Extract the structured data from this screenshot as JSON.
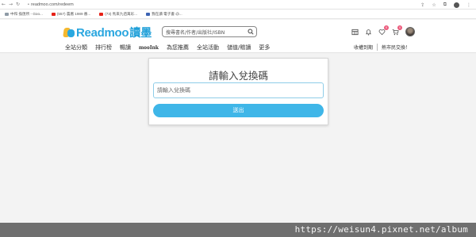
{
  "browser": {
    "url": "readmoo.com/redeem",
    "nav": {
      "back": "←",
      "forward": "→",
      "reload": "↻",
      "lock": "🔒"
    },
    "right_icons": {
      "share": "⇪",
      "star": "☆",
      "extensions": "⧉",
      "menu": "⋮"
    },
    "bookmarks": [
      {
        "icon": "grey",
        "label": "中和 換匯所 - Goo..."
      },
      {
        "icon": "red",
        "label": "(557) 農曆 1989 番..."
      },
      {
        "icon": "red",
        "label": "(73) 馬來九佰萬彩..."
      },
      {
        "icon": "blue",
        "label": "我在讀 電子書 @..."
      }
    ]
  },
  "site": {
    "logo_text": "Readmoo",
    "logo_cn": "讀墨",
    "search_placeholder": "搜尋書名/作者/出版社/ISBN",
    "nav": [
      "全站分類",
      "排行榜",
      "暢讀",
      "mooInk",
      "為您推薦",
      "全站活動",
      "儲值/贈讀",
      "更多"
    ],
    "header_links": [
      "收權到期",
      "熱市民交換！"
    ],
    "badges": {
      "heart": "0",
      "cart": "0"
    },
    "accent_color": "#3fb6e8"
  },
  "redeem": {
    "title": "請輸入兌換碼",
    "input_placeholder": "請輸入兌換碼",
    "input_value": "",
    "submit_label": "送出"
  },
  "watermark": "https://weisun4.pixnet.net/album"
}
